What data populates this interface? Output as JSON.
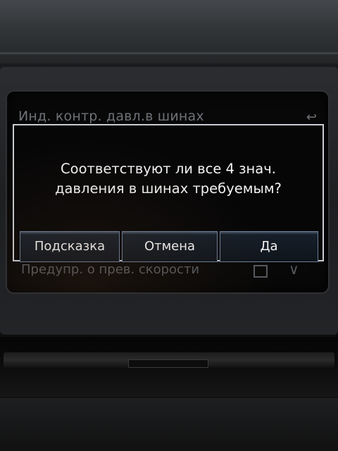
{
  "background": {
    "title": "Инд. контр. давл.в шинах",
    "back_icon": "↩",
    "setting_row": "Предупр. о прев. скорости",
    "checkbox_checked": false,
    "chevron_icon": "∨"
  },
  "dialog": {
    "message": "Соответствуют ли все 4 знач.\nдавления в шинах требуемым?",
    "buttons": {
      "hint": "Подсказка",
      "cancel": "Отмена",
      "yes": "Да"
    }
  },
  "colors": {
    "screen_bg": "#080808",
    "dialog_border": "#c9cdd2",
    "button_border": "#6c7f98",
    "text": "#f4f4f4"
  }
}
